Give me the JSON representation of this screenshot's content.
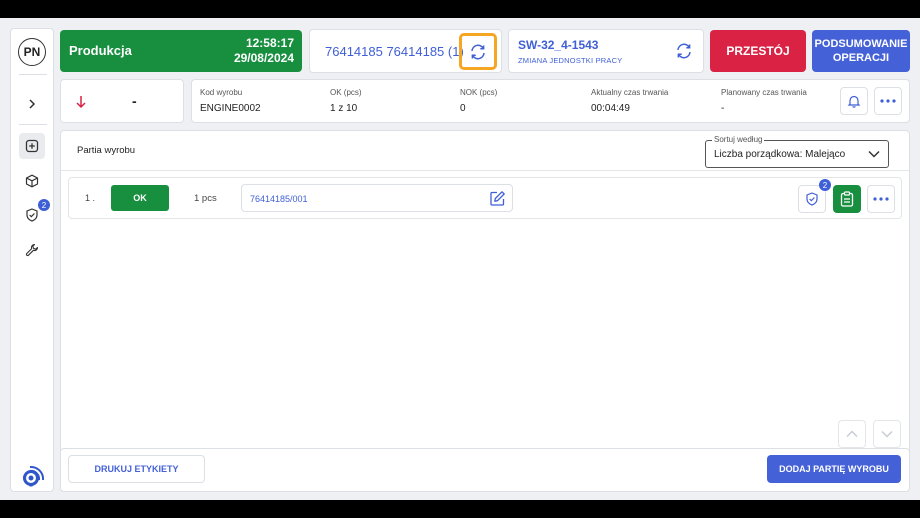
{
  "sidebar": {
    "avatar_initials": "PN",
    "badge_count": "2",
    "items": [
      {
        "icon": "chevron-right-icon"
      },
      {
        "icon": "add-box-icon"
      },
      {
        "icon": "cube-icon"
      },
      {
        "icon": "shield-check-icon"
      },
      {
        "icon": "wrench-icon"
      }
    ],
    "logo_icon": "gear-logo-icon"
  },
  "status": {
    "label": "Produkcja",
    "time": "12:58:17",
    "date": "29/08/2024",
    "color": "#178f3f"
  },
  "order": {
    "text": "76414185 76414185  (1)"
  },
  "workstation": {
    "code": "SW-32_4-1543",
    "subtitle": "ZMIANA JEDNOSTKI PRACY"
  },
  "actions": {
    "downtime_label": "PRZESTÓJ",
    "summary_label": "PODSUMOWANIE OPERACJI",
    "downtime_color": "#d92244",
    "summary_color": "#4461d8"
  },
  "info": {
    "direction_value": "-",
    "product_code_label": "Kod wyrobu",
    "product_code": "ENGINE0002",
    "ok_label": "OK (pcs)",
    "ok_value": "1 z 10",
    "nok_label": "NOK (pcs)",
    "nok_value": "0",
    "current_duration_label": "Aktualny czas trwania",
    "current_duration": "00:04:49",
    "planned_duration_label": "Planowany czas trwania",
    "planned_duration": "-"
  },
  "batch": {
    "title": "Partia wyrobu",
    "sort_legend": "Sortuj według",
    "sort_value": "Liczba porządkowa: Malejąco",
    "rows": [
      {
        "index": "1 .",
        "status": "OK",
        "qty": "1 pcs",
        "serial": "76414185/001",
        "badge": "2"
      }
    ]
  },
  "footer": {
    "print_label": "DRUKUJ ETYKIETY",
    "add_batch_label": "DODAJ PARTIĘ WYROBU"
  }
}
